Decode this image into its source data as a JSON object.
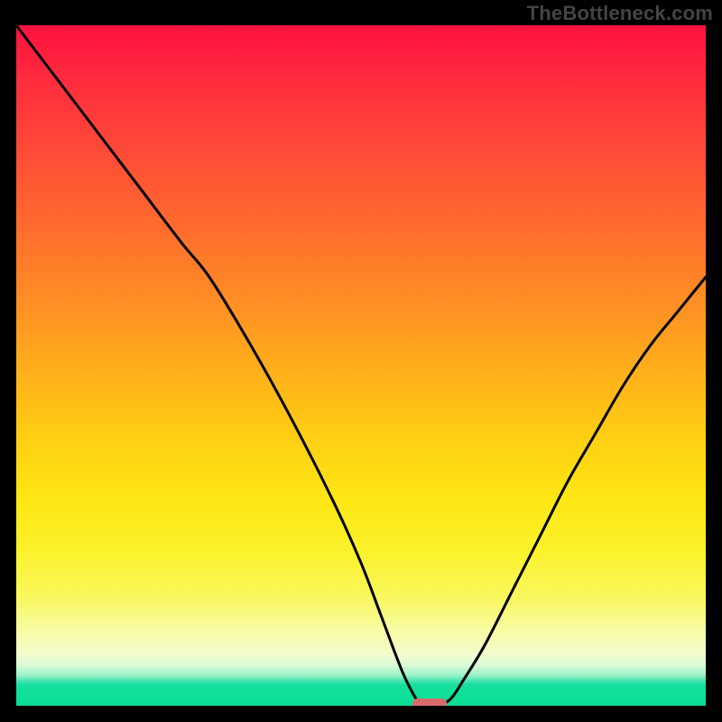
{
  "watermark": "TheBottleneck.com",
  "colors": {
    "background": "#000000",
    "curve": "#000000",
    "marker": "#d96a6c",
    "gradient_top": "#ff103f",
    "gradient_mid": "#ffd013",
    "gradient_bottom": "#0bdc93"
  },
  "chart_data": {
    "type": "line",
    "title": "",
    "xlabel": "",
    "ylabel": "",
    "xlim": [
      0,
      100
    ],
    "ylim": [
      0,
      100
    ],
    "grid": false,
    "legend": false,
    "series": [
      {
        "name": "bottleneck-curve",
        "x": [
          0,
          6,
          12,
          18,
          24,
          28,
          34,
          40,
          46,
          50,
          53,
          56,
          58,
          59,
          61,
          63,
          65,
          68,
          72,
          76,
          80,
          84,
          88,
          92,
          96,
          100
        ],
        "values": [
          100,
          92,
          84,
          76,
          68,
          63,
          53,
          42,
          30,
          21,
          13,
          5,
          1,
          0,
          0,
          1,
          4,
          9,
          17,
          25,
          33,
          40,
          47,
          53,
          58,
          63
        ]
      }
    ],
    "marker": {
      "name": "optimal-zone",
      "x_start": 57.5,
      "x_end": 62.5,
      "y": 0
    }
  }
}
